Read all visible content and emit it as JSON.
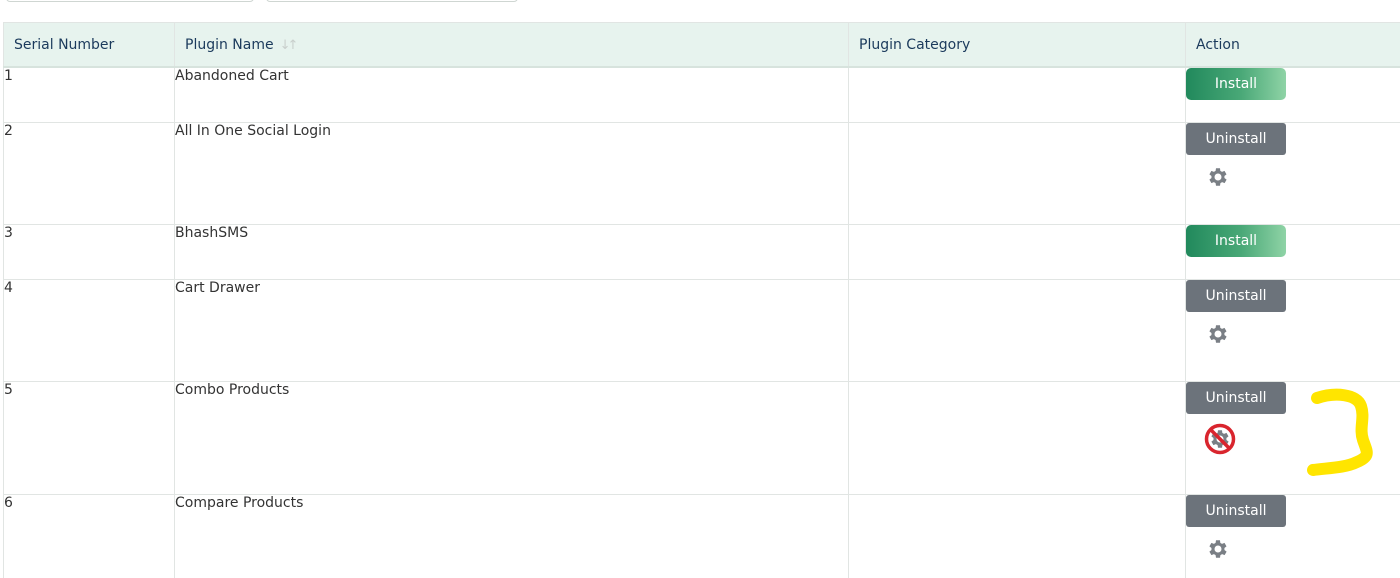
{
  "table": {
    "headers": {
      "serial": "Serial Number",
      "name": "Plugin Name",
      "category": "Plugin Category",
      "action": "Action"
    },
    "rows": [
      {
        "serial": "1",
        "name": "Abandoned Cart",
        "category": "",
        "button": "Install",
        "status": "not-installed",
        "settings": "none"
      },
      {
        "serial": "2",
        "name": "All In One Social Login",
        "category": "",
        "button": "Uninstall",
        "status": "installed",
        "settings": "gear-icon"
      },
      {
        "serial": "3",
        "name": "BhashSMS",
        "category": "",
        "button": "Install",
        "status": "not-installed",
        "settings": "none"
      },
      {
        "serial": "4",
        "name": "Cart Drawer",
        "category": "",
        "button": "Uninstall",
        "status": "installed",
        "settings": "gear-icon"
      },
      {
        "serial": "5",
        "name": "Combo Products",
        "category": "",
        "button": "Uninstall",
        "status": "installed",
        "settings": "gear-disabled-icon"
      },
      {
        "serial": "6",
        "name": "Compare Products",
        "category": "",
        "button": "Uninstall",
        "status": "installed",
        "settings": "gear-icon"
      }
    ]
  },
  "icons": {
    "sort": "sort-arrows-icon",
    "settings": "gear-icon",
    "settings_disabled": "gear-disabled-icon",
    "annotation": "yellow-bracket-annotation"
  },
  "colors": {
    "header_bg": "#e7f3ee",
    "header_text": "#1b3a5c",
    "install_start": "#21895c",
    "install_end": "#8fd3a6",
    "uninstall": "#6c737b",
    "gear": "#7a7f85",
    "forbidden": "#d9252e",
    "highlight": "#ffe500"
  }
}
